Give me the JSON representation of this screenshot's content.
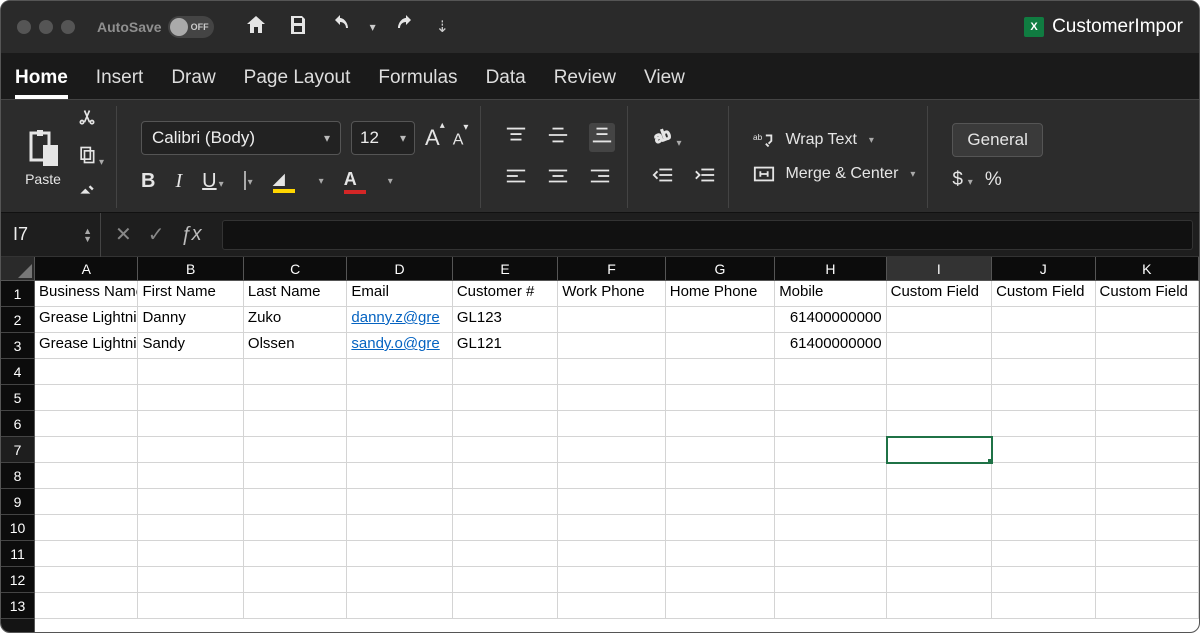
{
  "titlebar": {
    "autosave_label": "AutoSave",
    "autosave_state": "OFF",
    "doc_name": "CustomerImpor"
  },
  "tabs": {
    "items": [
      "Home",
      "Insert",
      "Draw",
      "Page Layout",
      "Formulas",
      "Data",
      "Review",
      "View"
    ],
    "active": "Home"
  },
  "ribbon": {
    "paste_label": "Paste",
    "font_name": "Calibri (Body)",
    "font_size": "12",
    "wrap_text": "Wrap Text",
    "merge_center": "Merge & Center",
    "number_format": "General"
  },
  "formula_bar": {
    "cell_ref": "I7",
    "formula": ""
  },
  "sheet": {
    "columns": [
      "A",
      "B",
      "C",
      "D",
      "E",
      "F",
      "G",
      "H",
      "I",
      "J",
      "K"
    ],
    "row_count": 13,
    "selected_cell": "I7",
    "headers": {
      "A": "Business Name",
      "B": "First Name",
      "C": "Last Name",
      "D": "Email",
      "E": "Customer #",
      "F": "Work Phone",
      "G": "Home Phone",
      "H": "Mobile",
      "I": "Custom Field",
      "J": "Custom Field",
      "K": "Custom Field"
    },
    "data": [
      {
        "A": "Grease Lightning",
        "B": "Danny",
        "C": "Zuko",
        "D": "danny.z@greaselightning.com",
        "D_display": "danny.z@gre",
        "E": "GL123",
        "F": "",
        "G": "",
        "H": "61400000000"
      },
      {
        "A": "Grease Lightning",
        "B": "Sandy",
        "C": "Olssen",
        "D": "sandy.o@greaselightning.com",
        "D_display": "sandy.o@gre",
        "E": "GL121",
        "F": "",
        "G": "",
        "H": "61400000000"
      }
    ]
  },
  "chart_data": {
    "type": "table",
    "title": "CustomerImport",
    "columns": [
      "Business Name",
      "First Name",
      "Last Name",
      "Email",
      "Customer #",
      "Work Phone",
      "Home Phone",
      "Mobile",
      "Custom Field",
      "Custom Field",
      "Custom Field"
    ],
    "rows": [
      [
        "Grease Lightning",
        "Danny",
        "Zuko",
        "danny.z@gre",
        "GL123",
        "",
        "",
        "61400000000",
        "",
        "",
        ""
      ],
      [
        "Grease Lightning",
        "Sandy",
        "Olssen",
        "sandy.o@gre",
        "GL121",
        "",
        "",
        "61400000000",
        "",
        "",
        ""
      ]
    ]
  }
}
